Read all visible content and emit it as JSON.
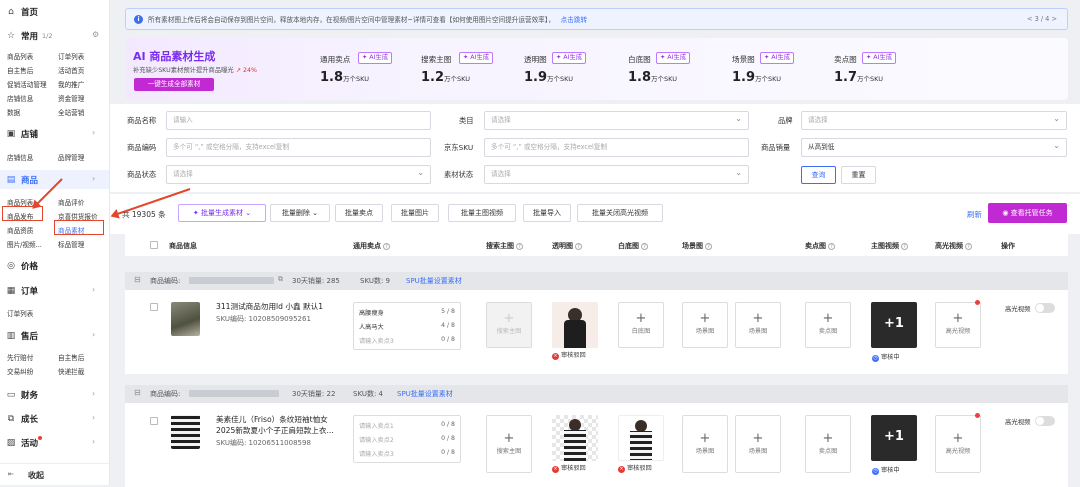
{
  "sidebar": {
    "home": "首页",
    "common": "常用",
    "common_count": "1/2",
    "common_items": [
      "商品列表",
      "订单列表",
      "自主售后",
      "活动首页",
      "促销活动管理",
      "我的推广",
      "店铺信息",
      "资金管理",
      "数据",
      "全站营销"
    ],
    "shop": "店铺",
    "shop_items": [
      "店铺信息",
      "品牌管理"
    ],
    "goods": "商品",
    "goods_items": [
      "商品列表",
      "商品评价",
      "商品发布",
      "京喜供货报价",
      "商品资质",
      "商品素材",
      "图片/视频...",
      "标品管理"
    ],
    "price": "价格",
    "order": "订单",
    "order_items": [
      "订单列表"
    ],
    "aftersale": "售后",
    "aftersale_items": [
      "先行赔付",
      "自主售后",
      "交易纠纷",
      "快递拦截"
    ],
    "finance": "财务",
    "growth": "成长",
    "activity": "活动",
    "collapse": "收起"
  },
  "banner": {
    "text": "所有素材图上传后将会自动保存到图片空间，释放本地内存，在视频/图片空间中管理素材~详情可查看【如何使用图片空间提升运营效率】，",
    "link": "点击跳转",
    "pager": "< 3 / 4 >"
  },
  "ai_card": {
    "title": "AI 商品素材生成",
    "subtitle": "补充缺少SKU素材预计提升商品曝光",
    "uplift": "↗ 24%",
    "button": "一键生成全部素材",
    "ai_label": "AI生成",
    "metrics": [
      {
        "label": "通用卖点",
        "value": "1.8",
        "unit": "万个SKU"
      },
      {
        "label": "搜索主图",
        "value": "1.2",
        "unit": "万个SKU"
      },
      {
        "label": "透明图",
        "value": "1.9",
        "unit": "万个SKU"
      },
      {
        "label": "白底图",
        "value": "1.8",
        "unit": "万个SKU"
      },
      {
        "label": "场景图",
        "value": "1.9",
        "unit": "万个SKU"
      },
      {
        "label": "卖点图",
        "value": "1.7",
        "unit": "万个SKU"
      }
    ]
  },
  "filters": {
    "name_label": "商品名称",
    "name_ph": "请输入",
    "category_label": "类目",
    "category_ph": "请选择",
    "brand_label": "品牌",
    "brand_ph": "请选择",
    "code_label": "商品编码",
    "code_ph": "多个可 “,” 或空格分隔，支持excel复制",
    "jdsku_label": "京东SKU",
    "jdsku_ph": "多个可 “,” 或空格分隔，支持excel复制",
    "sales_label": "商品销量",
    "sales_value": "从高到低",
    "status_label": "商品状态",
    "status_ph": "请选择",
    "material_label": "素材状态",
    "material_ph": "请选择",
    "query": "查询",
    "reset": "重置"
  },
  "toolbar": {
    "count": "共 19305 条",
    "batch_gen": "✦ 批量生成素材",
    "batch_delete": "批量删除",
    "batch_selling": "批量卖点",
    "batch_image": "批量图片",
    "batch_main_video": "批量主图视频",
    "batch_import": "批量导入",
    "batch_close_highlight": "批量关闭高光视频",
    "refresh": "刷新",
    "view_tasks": "查看托管任务"
  },
  "table": {
    "headers": [
      "商品信息",
      "通用卖点",
      "搜索主图",
      "透明图",
      "白底图",
      "场景图",
      "卖点图",
      "主图视频",
      "高光视频",
      "操作"
    ],
    "groups": [
      {
        "code_label": "商品编码:",
        "sales": "30天销量: 285",
        "sku": "SKU数: 9",
        "link": "SPU批量设置素材"
      },
      {
        "code_label": "商品编码:",
        "sales": "30天销量: 22",
        "sku": "SKU数: 4",
        "link": "SPU批量设置素材"
      }
    ],
    "rows": [
      {
        "title": "311测试商品勿用ld 小鑫 默认1",
        "sku": "SKU编码: 10208509095261",
        "selling": [
          {
            "text": "高腰瘦身",
            "n": "5 / 8"
          },
          {
            "text": "人高马大",
            "n": "4 / 8"
          },
          {
            "text": "请输入卖点3",
            "n": "0 / 8"
          }
        ],
        "search_main": "搜索主图",
        "transparent_status": "审核驳回",
        "white": "白底图",
        "scene1": "场景图",
        "scene2": "场景图",
        "selling_img": "卖点图",
        "video_count": "+1",
        "video_status": "审核中",
        "highlight": "高光视频",
        "highlight_toggle": "高光视频"
      },
      {
        "title": "美素佳儿（Friso）条纹短袖t恤女2025新款夏小个子正肩短款上衣...",
        "sku": "SKU编码: 10206511008598",
        "selling": [
          {
            "text": "请输入卖点1",
            "n": "0 / 8"
          },
          {
            "text": "请输入卖点2",
            "n": "0 / 8"
          },
          {
            "text": "请输入卖点3",
            "n": "0 / 8"
          }
        ],
        "search_main": "搜索主图",
        "transparent_status": "审核驳回",
        "white_status": "审核驳回",
        "scene1": "场景图",
        "scene2": "场景图",
        "selling_img": "卖点图",
        "video_count": "+1",
        "video_status": "审核中",
        "highlight": "高光视频",
        "highlight_toggle": "高光视频"
      }
    ]
  },
  "colors": {
    "accent": "#3b6ff5",
    "ai": "#9333ea",
    "annotation": "#e2462c",
    "danger": "#e53935"
  }
}
